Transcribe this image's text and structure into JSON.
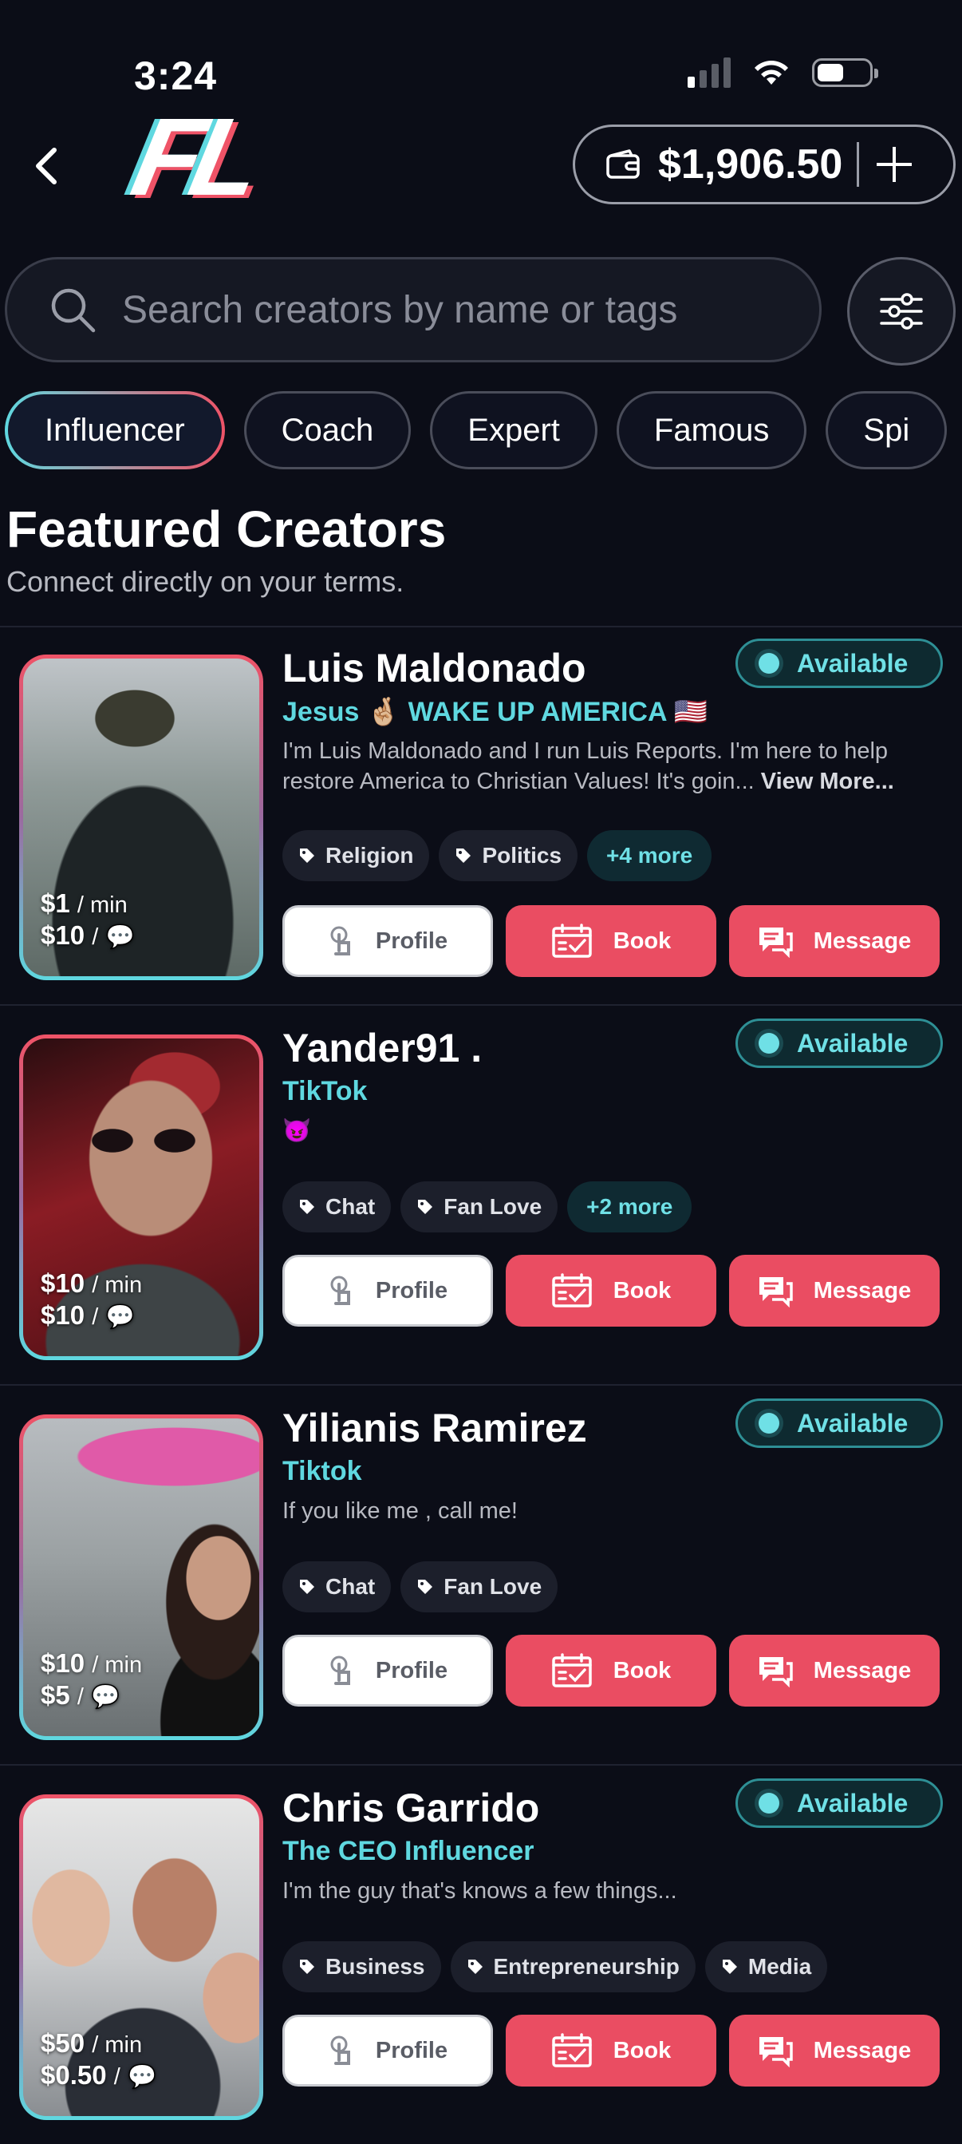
{
  "status_bar": {
    "time": "3:24"
  },
  "header": {
    "logo_text": "FL",
    "wallet_amount": "$1,906.50"
  },
  "search": {
    "placeholder": "Search creators by name or tags"
  },
  "categories": [
    "Influencer",
    "Coach",
    "Expert",
    "Famous",
    "Spi"
  ],
  "section": {
    "title": "Featured Creators",
    "subtitle": "Connect directly on your terms."
  },
  "labels": {
    "available": "Available",
    "profile": "Profile",
    "book": "Book",
    "message": "Message",
    "min": "/ min",
    "per_msg": "/"
  },
  "creators": [
    {
      "name": "Luis Maldonado",
      "tagline": "Jesus 🤞🏼 WAKE UP AMERICA 🇺🇸",
      "bio": "I'm Luis Maldonado and I run Luis Reports. I'm here to help restore America to Christian Values! It's goin...",
      "bio_more": "View More...",
      "rate_min": "$1",
      "rate_msg": "$10",
      "tags": [
        "Religion",
        "Politics"
      ],
      "more": "+4 more"
    },
    {
      "name": "Yander91 .",
      "tagline": "TikTok",
      "bio": "😈",
      "rate_min": "$10",
      "rate_msg": "$10",
      "tags": [
        "Chat",
        "Fan Love"
      ],
      "more": "+2 more"
    },
    {
      "name": "Yilianis Ramirez",
      "tagline": "Tiktok",
      "bio": "If you like me , call me!",
      "rate_min": "$10",
      "rate_msg": "$5",
      "tags": [
        "Chat",
        "Fan Love"
      ]
    },
    {
      "name": "Chris Garrido",
      "tagline": "The CEO Influencer",
      "bio": "I'm the guy that's knows a few things...",
      "rate_min": "$50",
      "rate_msg": "$0.50",
      "tags": [
        "Business",
        "Entrepreneurship",
        "Media"
      ]
    }
  ],
  "colors": {
    "background": "#0b0d17",
    "accent_teal": "#5fd8e0",
    "accent_red": "#ea4d62"
  }
}
